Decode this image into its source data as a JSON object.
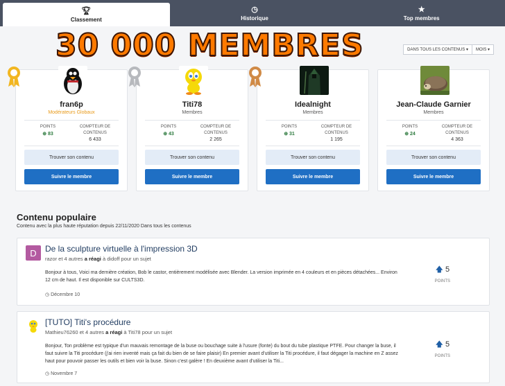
{
  "tabs": [
    {
      "label": "Classement",
      "icon": "trophy-icon"
    },
    {
      "label": "Historique",
      "icon": "clock-icon"
    },
    {
      "label": "Top membres",
      "icon": "star-icon"
    }
  ],
  "banner": "30 000 MEMBRES",
  "filters": {
    "scope": "DANS TOUS LES CONTENUS ▾",
    "period": "MOIS ▾"
  },
  "leaders": [
    {
      "name": "fran6p",
      "group": "Modérateurs Globaux",
      "points_label": "POINTS",
      "points": "83",
      "content_label_1": "COMPTEUR DE",
      "content_label_2": "CONTENUS",
      "content": "6 433",
      "find_label": "Trouver son contenu",
      "follow_label": "Suivre le membre",
      "medal": "gold"
    },
    {
      "name": "Titi78",
      "group": "Membres",
      "points_label": "POINTS",
      "points": "43",
      "content_label_1": "COMPTEUR DE",
      "content_label_2": "CONTENUS",
      "content": "2 265",
      "find_label": "Trouver son contenu",
      "follow_label": "Suivre le membre",
      "medal": "silver"
    },
    {
      "name": "Idealnight",
      "group": "Membres",
      "points_label": "POINTS",
      "points": "31",
      "content_label_1": "COMPTEUR DE",
      "content_label_2": "CONTENUS",
      "content": "1 195",
      "find_label": "Trouver son contenu",
      "follow_label": "Suivre le membre",
      "medal": "bronze"
    },
    {
      "name": "Jean-Claude Garnier",
      "group": "Membres",
      "points_label": "POINTS",
      "points": "24",
      "content_label_1": "COMPTEUR DE",
      "content_label_2": "CONTENUS",
      "content": "4 363",
      "find_label": "Trouver son contenu",
      "follow_label": "Suivre le membre",
      "medal": "none"
    }
  ],
  "colors": {
    "gold": "#f2b620",
    "silver": "#b7b9bd",
    "bronze": "#d08a46",
    "primary": "#1f6fc4"
  },
  "popular": {
    "title": "Contenu populaire",
    "subtitle": "Contenu avec la plus haute réputation depuis 22/11/2020 Dans tous les contenus",
    "items": [
      {
        "thumb_letter": "D",
        "title": "De la sculpture virtuelle à l'impression 3D",
        "meta_start": "razor et 4 autres ",
        "meta_action": "a réagi",
        "meta_end": " à didoff pour un sujet",
        "body": "Bonjour à tous, Voici ma dernière création, Bob le castor, entièrement modélisée avec Blender. La version imprimée en 4 couleurs et en pièces détachées... Environ 12 cm de haut. Il est disponible sur CULTS3D.",
        "date": "Décembre 10",
        "rep": "5",
        "rep_label": "POINTS"
      },
      {
        "thumb_letter": "",
        "title": "[TUTO] Titi's procédure",
        "meta_start": "Mathieu76260 et 4 autres ",
        "meta_action": "a réagi",
        "meta_end": " à Titi78 pour un sujet",
        "body": "Bonjour, Ton problème est typique d'un mauvais remontage de la buse ou bouchage suite à l'usure (fonte) du bout du tube plastique PTFE. Pour changer la buse, il faut suivre la Titi procédure (j'ai rien inventé mais ça fait du bien de se faire plaisir) En premier avant d'utiliser la Titi procédure, il faut dégager la machine en Z assez haut pour pouvoir passer les outils et bien voir la buse. Sinon c'est galère ! En deuxième avant d'utiliser la Titi...",
        "date": "Novembre 7",
        "rep": "5",
        "rep_label": "POINTS"
      }
    ]
  }
}
